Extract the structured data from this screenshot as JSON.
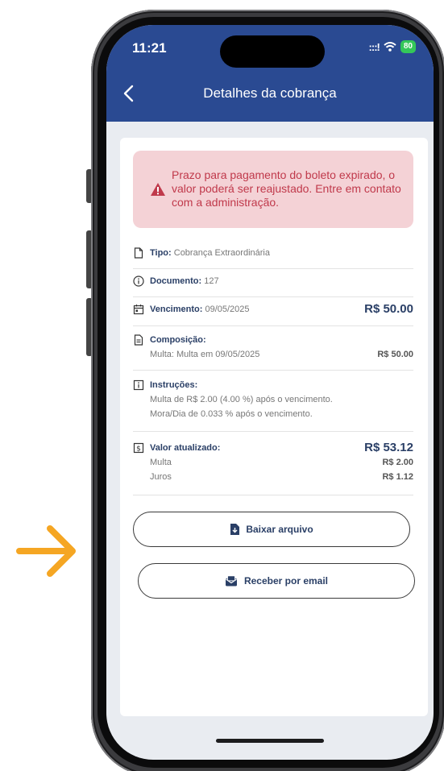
{
  "status_bar": {
    "time": "11:21",
    "signal": ":::!",
    "battery": "80"
  },
  "header": {
    "title": "Detalhes da cobrança"
  },
  "alert": {
    "message": "Prazo para pagamento do boleto expirado, o valor poderá ser reajustado. Entre em contato com a administração."
  },
  "details": {
    "tipo": {
      "label": "Tipo:",
      "value": "Cobrança Extraordinária"
    },
    "documento": {
      "label": "Documento:",
      "value": "127"
    },
    "vencimento": {
      "label": "Vencimento:",
      "value": "09/05/2025",
      "amount": "R$ 50.00"
    },
    "composicao": {
      "label": "Composição:",
      "item": "Multa: Multa em 09/05/2025",
      "amount": "R$ 50.00"
    },
    "instrucoes": {
      "label": "Instruções:",
      "line1": "Multa de R$ 2.00 (4.00 %) após o vencimento.",
      "line2": "Mora/Dia de 0.033 % após o vencimento."
    },
    "valor_atualizado": {
      "label": "Valor atualizado:",
      "amount": "R$ 53.12",
      "multa_label": "Multa",
      "multa_amount": "R$ 2.00",
      "juros_label": "Juros",
      "juros_amount": "R$ 1.12"
    }
  },
  "buttons": {
    "download": "Baixar arquivo",
    "email": "Receber por email"
  },
  "colors": {
    "header": "#2a4a92",
    "alert_bg": "#f4d2d6",
    "alert_text": "#c0394b",
    "arrow": "#f5a623"
  }
}
